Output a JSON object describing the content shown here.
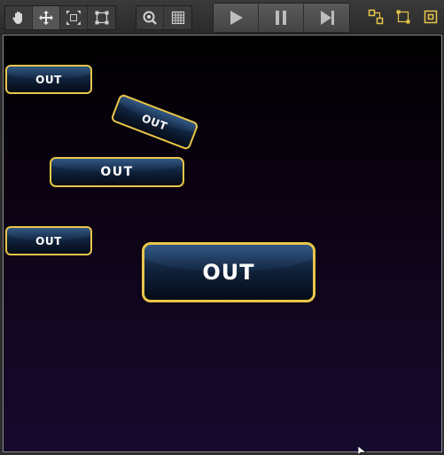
{
  "toolbar": {
    "tools": [
      {
        "name": "hand-tool",
        "icon": "hand-icon",
        "active": false
      },
      {
        "name": "move-tool",
        "icon": "move-arrows-icon",
        "active": true
      },
      {
        "name": "scale-tool",
        "icon": "scale-icon",
        "active": false
      },
      {
        "name": "rect-tool",
        "icon": "rect-transform-icon",
        "active": false
      }
    ],
    "view_tools": [
      {
        "name": "zoom-tool",
        "icon": "zoom-icon"
      },
      {
        "name": "grid-tool",
        "icon": "grid-icon"
      }
    ],
    "playback": [
      {
        "name": "play",
        "icon": "play-icon"
      },
      {
        "name": "pause",
        "icon": "pause-icon"
      },
      {
        "name": "step",
        "icon": "step-icon"
      }
    ],
    "snap_tools": [
      {
        "name": "snap-pivot",
        "icon": "pivot-snap-icon"
      },
      {
        "name": "snap-bounds",
        "icon": "bounds-snap-icon"
      },
      {
        "name": "snap-center",
        "icon": "center-snap-icon"
      }
    ]
  },
  "scene": {
    "buttons": [
      {
        "label": "OUT"
      },
      {
        "label": "OUT"
      },
      {
        "label": "OUT"
      },
      {
        "label": "OUT"
      },
      {
        "label": "OUT"
      }
    ]
  },
  "colors": {
    "accent": "#e9c64a",
    "button_fill_top": "#23466e",
    "button_fill_bottom": "#050b16",
    "scene_top": "#000000",
    "scene_bottom": "#160a2e"
  }
}
